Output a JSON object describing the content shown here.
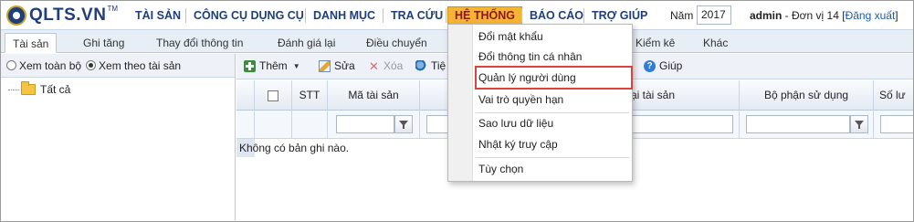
{
  "app": {
    "logo": "QLTS.VN",
    "logo_tm": "TM"
  },
  "menu": {
    "items": [
      "TÀI SẢN",
      "CÔNG CỤ DỤNG CỤ",
      "DANH MỤC",
      "TRA CỨU",
      "HỆ THỐNG",
      "BÁO CÁO",
      "TRỢ GIÚP"
    ],
    "active": "HỆ THỐNG"
  },
  "header": {
    "year_label": "Năm",
    "year_value": "2017",
    "user": "admin",
    "unit": " - Đơn vị 14 [",
    "logout": "Đăng xuất",
    "close_bracket": "]"
  },
  "tabs": [
    "Tài sản",
    "Ghi tăng",
    "Thay đổi thông tin",
    "Đánh giá lại",
    "Điều chuyển",
    "Kiểm kê",
    "Khác"
  ],
  "left": {
    "view_all": "Xem toàn bộ",
    "view_by_asset": "Xem theo tài sản",
    "tree_root": "Tất cả"
  },
  "toolbar": {
    "add": "Thêm",
    "edit": "Sửa",
    "delete": "Xóa",
    "tools": "Tiệ",
    "help": "Giúp"
  },
  "grid": {
    "columns": [
      "STT",
      "Mã tài sản",
      "Loại tài sản",
      "Bộ phận sử dụng",
      "Số lư"
    ],
    "empty_text": "Không có bản ghi nào."
  },
  "dropdown": {
    "items": [
      "Đổi mật khẩu",
      "Đổi thông tin cá nhân",
      "Quản lý người dùng",
      "Vai trò quyền hạn",
      "Sao lưu dữ liệu",
      "Nhật ký truy cập",
      "Tùy chọn"
    ],
    "highlighted": "Quản lý người dùng"
  },
  "colors": {
    "brand": "#1f3e7a",
    "active_menu": "#f6b433",
    "highlight_outline": "#d9443b"
  }
}
